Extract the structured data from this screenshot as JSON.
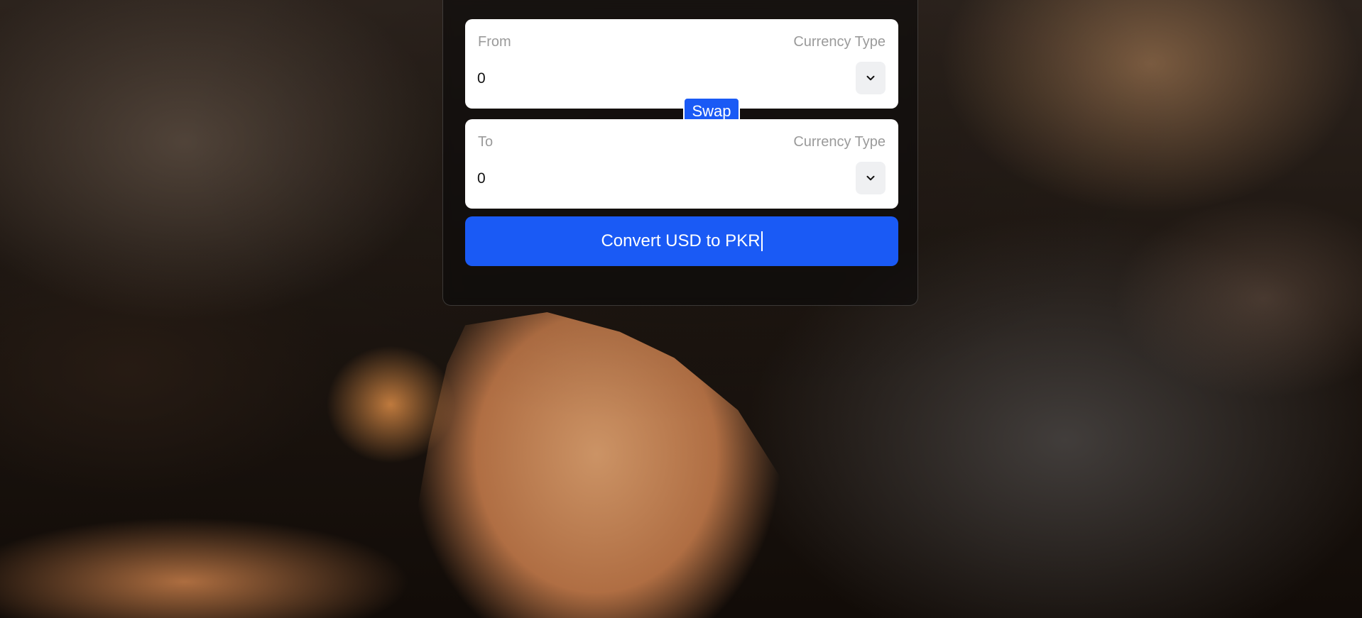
{
  "converter": {
    "from": {
      "label": "From",
      "currency_label": "Currency Type",
      "amount": "0",
      "select_icon": "chevron-down-icon"
    },
    "swap_label": "Swap",
    "to": {
      "label": "To",
      "currency_label": "Currency Type",
      "amount": "0",
      "select_icon": "chevron-down-icon"
    },
    "convert_label": "Convert USD to PKR"
  },
  "colors": {
    "accent": "#1a5af5",
    "panel": "#ffffff",
    "muted_text": "#9a9a9a"
  }
}
